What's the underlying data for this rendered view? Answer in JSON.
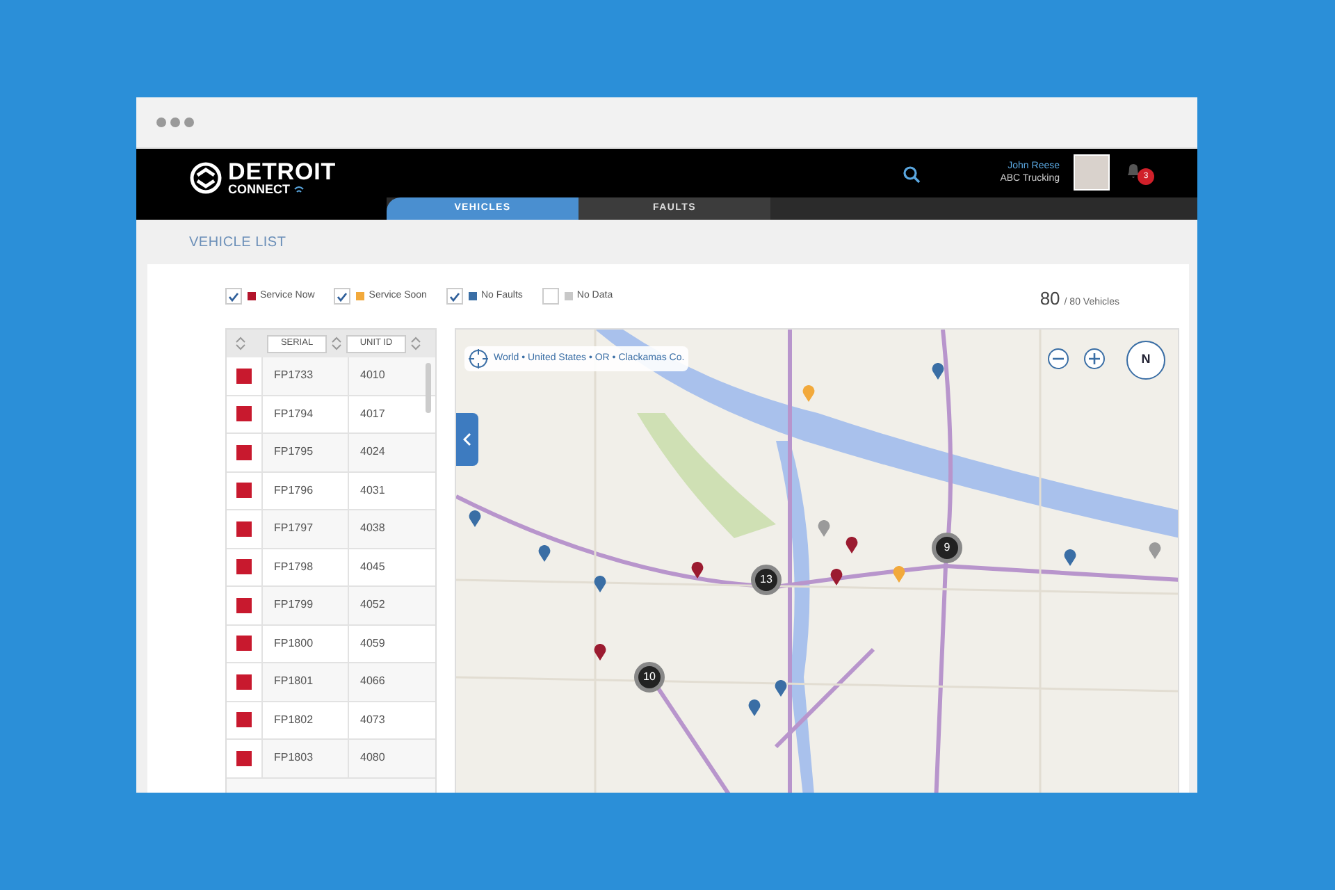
{
  "header": {
    "logo_title": "DETROIT",
    "logo_subtitle": "CONNECT",
    "user_name": "John Reese",
    "user_company": "ABC Trucking",
    "notification_count": "3"
  },
  "tabs": [
    {
      "label": "VEHICLES",
      "selected": true
    },
    {
      "label": "FAULTS",
      "selected": false
    }
  ],
  "page_title": "VEHICLE LIST",
  "filters": [
    {
      "label": "Service Now",
      "checked": true,
      "color": "#b3142b"
    },
    {
      "label": "Service Soon",
      "checked": true,
      "color": "#f2a93b"
    },
    {
      "label": "No Faults",
      "checked": true,
      "color": "#3a6ea5"
    },
    {
      "label": "No Data",
      "checked": false,
      "color": "#c8c8c8"
    }
  ],
  "vehicle_count": {
    "shown": "80",
    "total": "/ 80 Vehicles"
  },
  "table": {
    "columns": [
      "SERIAL",
      "UNIT ID"
    ],
    "rows": [
      {
        "color": "#c8192e",
        "serial": "FP1733",
        "unit_id": "4010"
      },
      {
        "color": "#c8192e",
        "serial": "FP1794",
        "unit_id": "4017"
      },
      {
        "color": "#c8192e",
        "serial": "FP1795",
        "unit_id": "4024"
      },
      {
        "color": "#c8192e",
        "serial": "FP1796",
        "unit_id": "4031"
      },
      {
        "color": "#c8192e",
        "serial": "FP1797",
        "unit_id": "4038"
      },
      {
        "color": "#c8192e",
        "serial": "FP1798",
        "unit_id": "4045"
      },
      {
        "color": "#c8192e",
        "serial": "FP1799",
        "unit_id": "4052"
      },
      {
        "color": "#c8192e",
        "serial": "FP1800",
        "unit_id": "4059"
      },
      {
        "color": "#c8192e",
        "serial": "FP1801",
        "unit_id": "4066"
      },
      {
        "color": "#c8192e",
        "serial": "FP1802",
        "unit_id": "4073"
      },
      {
        "color": "#c8192e",
        "serial": "FP1803",
        "unit_id": "4080"
      }
    ]
  },
  "map": {
    "breadcrumb": "World • United States • OR • Clackamas Co.",
    "compass": "N",
    "pins": [
      {
        "color": "#3a6ea5"
      },
      {
        "color": "#f2a93b"
      },
      {
        "color": "#3a6ea5"
      },
      {
        "color": "#3a6ea5"
      },
      {
        "color": "#3a6ea5"
      },
      {
        "color": "#9b1b30"
      },
      {
        "color": "#9a9a9a"
      },
      {
        "color": "#9b1b30"
      },
      {
        "color": "#9b1b30"
      },
      {
        "color": "#f2a93b"
      },
      {
        "color": "#3a6ea5"
      },
      {
        "color": "#9a9a9a"
      },
      {
        "color": "#9b1b30"
      },
      {
        "color": "#3a6ea5"
      },
      {
        "color": "#3a6ea5"
      }
    ],
    "clusters": [
      {
        "count": "13"
      },
      {
        "count": "9"
      },
      {
        "count": "10"
      }
    ]
  }
}
